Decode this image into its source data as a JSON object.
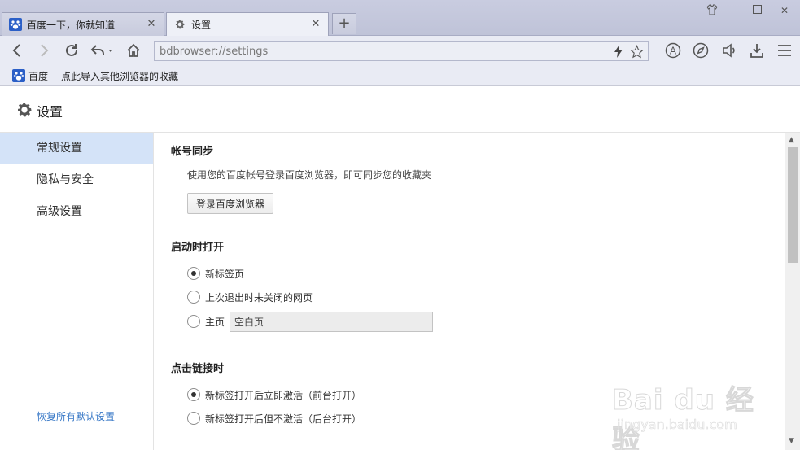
{
  "tabs": [
    {
      "label": "百度一下，你就知道",
      "icon": "baidu-paw-icon",
      "active": false
    },
    {
      "label": "设置",
      "icon": "gear-icon",
      "active": true
    }
  ],
  "toolbar": {
    "address_value": "bdbrowser://settings"
  },
  "bookmarks": [
    {
      "label": "百度",
      "icon": "baidu-paw-icon"
    },
    {
      "label": "点此导入其他浏览器的收藏"
    }
  ],
  "settings": {
    "title": "设置",
    "sidebar": {
      "items": [
        {
          "label": "常规设置",
          "active": true
        },
        {
          "label": "隐私与安全",
          "active": false
        },
        {
          "label": "高级设置",
          "active": false
        }
      ],
      "restore_label": "恢复所有默认设置"
    },
    "account_sync": {
      "title": "帐号同步",
      "description": "使用您的百度帐号登录百度浏览器，即可同步您的收藏夹",
      "login_button": "登录百度浏览器"
    },
    "startup": {
      "title": "启动时打开",
      "options": [
        {
          "label": "新标签页",
          "checked": true
        },
        {
          "label": "上次退出时未关闭的网页",
          "checked": false
        },
        {
          "label": "主页",
          "checked": false
        }
      ],
      "home_value": "空白页"
    },
    "link_click": {
      "title": "点击链接时",
      "options": [
        {
          "label": "新标签打开后立即激活（前台打开）",
          "checked": true
        },
        {
          "label": "新标签打开后但不激活（后台打开）",
          "checked": false
        }
      ]
    }
  },
  "watermark": {
    "main": "Bai du 经验",
    "sub": "jingyan.baidu.com"
  },
  "colors": {
    "sidebar_active": "#d4e3f8",
    "link": "#3979c7"
  }
}
